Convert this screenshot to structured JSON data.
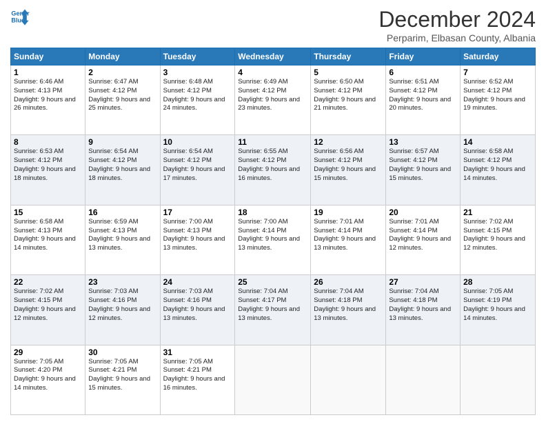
{
  "header": {
    "logo_line1": "General",
    "logo_line2": "Blue",
    "month_title": "December 2024",
    "location": "Perparim, Elbasan County, Albania"
  },
  "days_of_week": [
    "Sunday",
    "Monday",
    "Tuesday",
    "Wednesday",
    "Thursday",
    "Friday",
    "Saturday"
  ],
  "weeks": [
    [
      {
        "day": "1",
        "sunrise": "6:46 AM",
        "sunset": "4:13 PM",
        "daylight": "9 hours and 26 minutes."
      },
      {
        "day": "2",
        "sunrise": "6:47 AM",
        "sunset": "4:12 PM",
        "daylight": "9 hours and 25 minutes."
      },
      {
        "day": "3",
        "sunrise": "6:48 AM",
        "sunset": "4:12 PM",
        "daylight": "9 hours and 24 minutes."
      },
      {
        "day": "4",
        "sunrise": "6:49 AM",
        "sunset": "4:12 PM",
        "daylight": "9 hours and 23 minutes."
      },
      {
        "day": "5",
        "sunrise": "6:50 AM",
        "sunset": "4:12 PM",
        "daylight": "9 hours and 21 minutes."
      },
      {
        "day": "6",
        "sunrise": "6:51 AM",
        "sunset": "4:12 PM",
        "daylight": "9 hours and 20 minutes."
      },
      {
        "day": "7",
        "sunrise": "6:52 AM",
        "sunset": "4:12 PM",
        "daylight": "9 hours and 19 minutes."
      }
    ],
    [
      {
        "day": "8",
        "sunrise": "6:53 AM",
        "sunset": "4:12 PM",
        "daylight": "9 hours and 18 minutes."
      },
      {
        "day": "9",
        "sunrise": "6:54 AM",
        "sunset": "4:12 PM",
        "daylight": "9 hours and 18 minutes."
      },
      {
        "day": "10",
        "sunrise": "6:54 AM",
        "sunset": "4:12 PM",
        "daylight": "9 hours and 17 minutes."
      },
      {
        "day": "11",
        "sunrise": "6:55 AM",
        "sunset": "4:12 PM",
        "daylight": "9 hours and 16 minutes."
      },
      {
        "day": "12",
        "sunrise": "6:56 AM",
        "sunset": "4:12 PM",
        "daylight": "9 hours and 15 minutes."
      },
      {
        "day": "13",
        "sunrise": "6:57 AM",
        "sunset": "4:12 PM",
        "daylight": "9 hours and 15 minutes."
      },
      {
        "day": "14",
        "sunrise": "6:58 AM",
        "sunset": "4:12 PM",
        "daylight": "9 hours and 14 minutes."
      }
    ],
    [
      {
        "day": "15",
        "sunrise": "6:58 AM",
        "sunset": "4:13 PM",
        "daylight": "9 hours and 14 minutes."
      },
      {
        "day": "16",
        "sunrise": "6:59 AM",
        "sunset": "4:13 PM",
        "daylight": "9 hours and 13 minutes."
      },
      {
        "day": "17",
        "sunrise": "7:00 AM",
        "sunset": "4:13 PM",
        "daylight": "9 hours and 13 minutes."
      },
      {
        "day": "18",
        "sunrise": "7:00 AM",
        "sunset": "4:14 PM",
        "daylight": "9 hours and 13 minutes."
      },
      {
        "day": "19",
        "sunrise": "7:01 AM",
        "sunset": "4:14 PM",
        "daylight": "9 hours and 13 minutes."
      },
      {
        "day": "20",
        "sunrise": "7:01 AM",
        "sunset": "4:14 PM",
        "daylight": "9 hours and 12 minutes."
      },
      {
        "day": "21",
        "sunrise": "7:02 AM",
        "sunset": "4:15 PM",
        "daylight": "9 hours and 12 minutes."
      }
    ],
    [
      {
        "day": "22",
        "sunrise": "7:02 AM",
        "sunset": "4:15 PM",
        "daylight": "9 hours and 12 minutes."
      },
      {
        "day": "23",
        "sunrise": "7:03 AM",
        "sunset": "4:16 PM",
        "daylight": "9 hours and 12 minutes."
      },
      {
        "day": "24",
        "sunrise": "7:03 AM",
        "sunset": "4:16 PM",
        "daylight": "9 hours and 13 minutes."
      },
      {
        "day": "25",
        "sunrise": "7:04 AM",
        "sunset": "4:17 PM",
        "daylight": "9 hours and 13 minutes."
      },
      {
        "day": "26",
        "sunrise": "7:04 AM",
        "sunset": "4:18 PM",
        "daylight": "9 hours and 13 minutes."
      },
      {
        "day": "27",
        "sunrise": "7:04 AM",
        "sunset": "4:18 PM",
        "daylight": "9 hours and 13 minutes."
      },
      {
        "day": "28",
        "sunrise": "7:05 AM",
        "sunset": "4:19 PM",
        "daylight": "9 hours and 14 minutes."
      }
    ],
    [
      {
        "day": "29",
        "sunrise": "7:05 AM",
        "sunset": "4:20 PM",
        "daylight": "9 hours and 14 minutes."
      },
      {
        "day": "30",
        "sunrise": "7:05 AM",
        "sunset": "4:21 PM",
        "daylight": "9 hours and 15 minutes."
      },
      {
        "day": "31",
        "sunrise": "7:05 AM",
        "sunset": "4:21 PM",
        "daylight": "9 hours and 16 minutes."
      },
      null,
      null,
      null,
      null
    ]
  ],
  "labels": {
    "sunrise": "Sunrise:",
    "sunset": "Sunset:",
    "daylight": "Daylight:"
  }
}
